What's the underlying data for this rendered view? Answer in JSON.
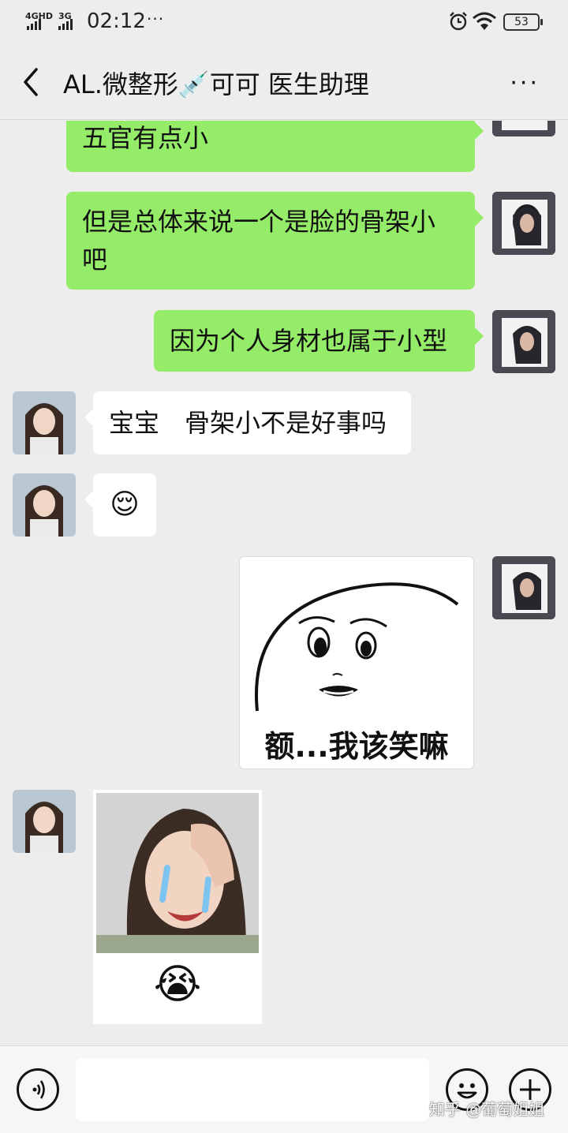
{
  "status": {
    "network1": "4GHD",
    "network2": "3G",
    "time": "02:12",
    "dots": "···",
    "battery": "53"
  },
  "header": {
    "back_icon": "chevron-left-icon",
    "title": "AL.微整形💉可可 医生助理",
    "more": "···"
  },
  "messages": [
    {
      "from": "me",
      "text": "五官有点小"
    },
    {
      "from": "me",
      "text": "但是总体来说一个是脸的骨架小吧"
    },
    {
      "from": "me",
      "text": "因为个人身材也属于小型"
    },
    {
      "from": "them",
      "text": "宝宝　骨架小不是好事吗"
    },
    {
      "from": "them",
      "text": "😌"
    },
    {
      "from": "me",
      "sticker_caption": "额...我该笑嘛"
    },
    {
      "from": "them",
      "sticker_emoji": "😭"
    }
  ],
  "input": {
    "voice_icon": "voice-icon",
    "emoji_icon": "emoji-face-icon",
    "add_icon": "plus-icon",
    "value": ""
  },
  "watermark": "知乎 @葡萄姐姐",
  "colors": {
    "background": "#ededed",
    "my_bubble": "#95ec69",
    "their_bubble": "#ffffff"
  }
}
